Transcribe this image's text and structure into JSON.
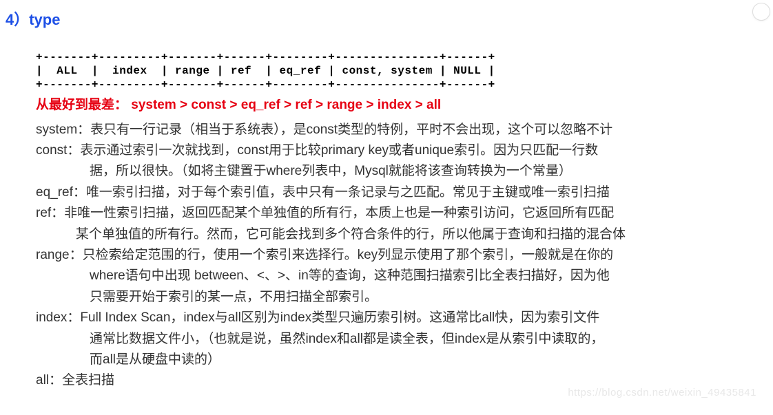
{
  "heading": "4）type",
  "ascii": {
    "top": "+-------+---------+-------+------+--------+---------------+------+",
    "middle": "|  ALL  |  index  | range | ref  | eq_ref | const, system | NULL |",
    "bottom": "+-------+---------+-------+------+--------+---------------+------+"
  },
  "caption": "从最好到最差： system > const > eq_ref > ref > range > index > all",
  "items": {
    "system": "system：表只有一行记录（相当于系统表），是const类型的特例，平时不会出现，这个可以忽略不计",
    "const1": "const：表示通过索引一次就找到，const用于比较primary key或者unique索引。因为只匹配一行数",
    "const2": "据，所以很快。（如将主键置于where列表中，Mysql就能将该查询转换为一个常量）",
    "eq_ref": "eq_ref：唯一索引扫描，对于每个索引值，表中只有一条记录与之匹配。常见于主键或唯一索引扫描",
    "ref1": "ref：非唯一性索引扫描，返回匹配某个单独值的所有行，本质上也是一种索引访问，它返回所有匹配",
    "ref2": "某个单独值的所有行。然而，它可能会找到多个符合条件的行，所以他属于查询和扫描的混合体",
    "range1": "range：只检索给定范围的行，使用一个索引来选择行。key列显示使用了那个索引，一般就是在你的",
    "range2": "where语句中出现 between、<、>、in等的查询，这种范围扫描索引比全表扫描好，因为他",
    "range3": "只需要开始于索引的某一点，不用扫描全部索引。",
    "index1": "index：Full Index Scan，index与all区别为index类型只遍历索引树。这通常比all快，因为索引文件",
    "index2": "通常比数据文件小，（也就是说，虽然index和all都是读全表，但index是从索引中读取的，",
    "index3": "而all是从硬盘中读的）",
    "all": "all：全表扫描"
  },
  "watermark": "https://blog.csdn.net/weixin_49435841"
}
